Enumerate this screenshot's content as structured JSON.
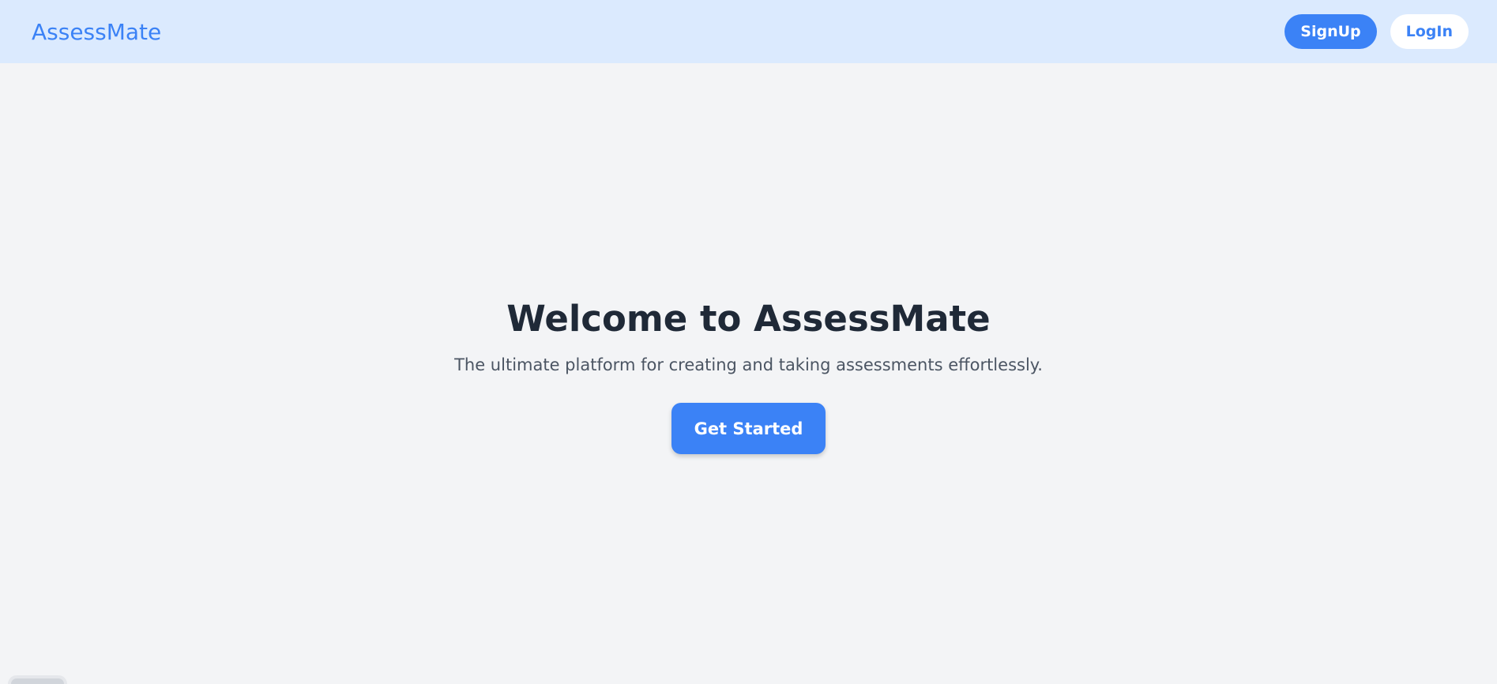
{
  "header": {
    "brand": "AssessMate",
    "signup_label": "SignUp",
    "login_label": "LogIn"
  },
  "hero": {
    "title": "Welcome to AssessMate",
    "subtitle": "The ultimate platform for creating and taking assessments effortlessly.",
    "cta_label": "Get Started"
  },
  "colors": {
    "accent": "#3b82f6",
    "header_bg": "#dbeafe",
    "page_bg": "#f3f4f6",
    "title_text": "#1f2937",
    "subtitle_text": "#4b5563"
  }
}
